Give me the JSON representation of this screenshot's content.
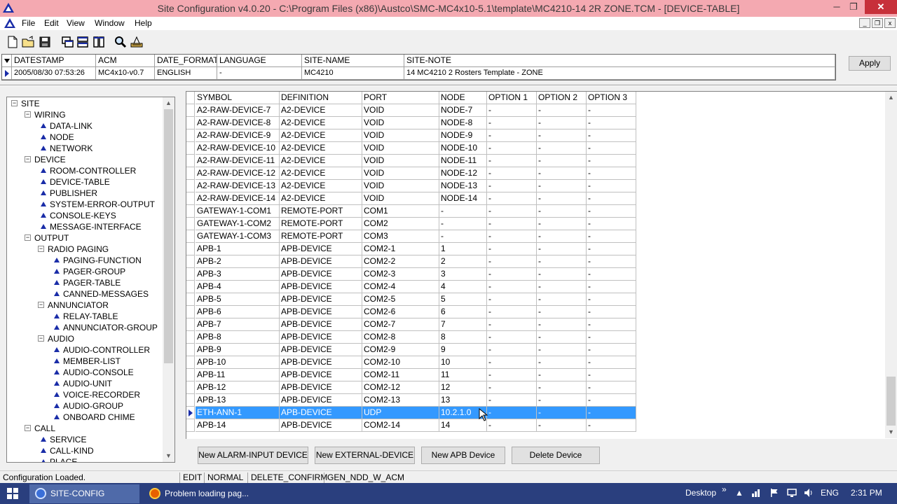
{
  "window": {
    "title": "Site Configuration v4.0.20 - C:\\Program Files (x86)\\Austco\\SMC-MC4x10-5.1\\template\\MC4210-14 2R ZONE.TCM - [DEVICE-TABLE]",
    "min": "─",
    "max": "❐",
    "close": "✕"
  },
  "menu": {
    "items": [
      "File",
      "Edit",
      "View",
      "Window",
      "Help"
    ],
    "mdi": [
      "_",
      "❐",
      "x"
    ]
  },
  "toolbar": {
    "icons": [
      "new-file-icon",
      "open-folder-icon",
      "save-icon",
      "cascade-icon",
      "tile-horizontal-icon",
      "tile-vertical-icon",
      "find-icon",
      "tool-icon"
    ]
  },
  "site_header": {
    "columns": [
      "DATESTAMP",
      "ACM",
      "DATE_FORMAT",
      "LANGUAGE",
      "SITE-NAME",
      "SITE-NOTE"
    ],
    "values": [
      "2005/08/30 07:53:26",
      "MC4x10-v0.7",
      "ENGLISH",
      "-",
      "MC4210",
      "14 MC4210 2 Rosters Template - ZONE"
    ],
    "apply_label": "Apply"
  },
  "tree": {
    "items": [
      {
        "label": "SITE",
        "level": 0,
        "type": "branch"
      },
      {
        "label": "WIRING",
        "level": 1,
        "type": "branch"
      },
      {
        "label": "DATA-LINK",
        "level": 2,
        "type": "leaf"
      },
      {
        "label": "NODE",
        "level": 2,
        "type": "leaf"
      },
      {
        "label": "NETWORK",
        "level": 2,
        "type": "leaf"
      },
      {
        "label": "DEVICE",
        "level": 1,
        "type": "branch"
      },
      {
        "label": "ROOM-CONTROLLER",
        "level": 2,
        "type": "leaf"
      },
      {
        "label": "DEVICE-TABLE",
        "level": 2,
        "type": "leaf"
      },
      {
        "label": "PUBLISHER",
        "level": 2,
        "type": "leaf"
      },
      {
        "label": "SYSTEM-ERROR-OUTPUT",
        "level": 2,
        "type": "leaf"
      },
      {
        "label": "CONSOLE-KEYS",
        "level": 2,
        "type": "leaf"
      },
      {
        "label": "MESSAGE-INTERFACE",
        "level": 2,
        "type": "leaf"
      },
      {
        "label": "OUTPUT",
        "level": 1,
        "type": "branch"
      },
      {
        "label": "RADIO PAGING",
        "level": 2,
        "type": "branch"
      },
      {
        "label": "PAGING-FUNCTION",
        "level": 3,
        "type": "leaf"
      },
      {
        "label": "PAGER-GROUP",
        "level": 3,
        "type": "leaf"
      },
      {
        "label": "PAGER-TABLE",
        "level": 3,
        "type": "leaf"
      },
      {
        "label": "CANNED-MESSAGES",
        "level": 3,
        "type": "leaf"
      },
      {
        "label": "ANNUNCIATOR",
        "level": 2,
        "type": "branch"
      },
      {
        "label": "RELAY-TABLE",
        "level": 3,
        "type": "leaf"
      },
      {
        "label": "ANNUNCIATOR-GROUP",
        "level": 3,
        "type": "leaf"
      },
      {
        "label": "AUDIO",
        "level": 2,
        "type": "branch"
      },
      {
        "label": "AUDIO-CONTROLLER",
        "level": 3,
        "type": "leaf"
      },
      {
        "label": "MEMBER-LIST",
        "level": 3,
        "type": "leaf"
      },
      {
        "label": "AUDIO-CONSOLE",
        "level": 3,
        "type": "leaf"
      },
      {
        "label": "AUDIO-UNIT",
        "level": 3,
        "type": "leaf"
      },
      {
        "label": "VOICE-RECORDER",
        "level": 3,
        "type": "leaf"
      },
      {
        "label": "AUDIO-GROUP",
        "level": 3,
        "type": "leaf"
      },
      {
        "label": "ONBOARD CHIME",
        "level": 3,
        "type": "leaf"
      },
      {
        "label": "CALL",
        "level": 1,
        "type": "branch"
      },
      {
        "label": "SERVICE",
        "level": 2,
        "type": "leaf"
      },
      {
        "label": "CALL-KIND",
        "level": 2,
        "type": "leaf"
      },
      {
        "label": "PLACE",
        "level": 2,
        "type": "leaf"
      }
    ]
  },
  "device_table": {
    "columns": [
      "SYMBOL",
      "DEFINITION",
      "PORT",
      "NODE",
      "OPTION 1",
      "OPTION 2",
      "OPTION 3"
    ],
    "selected_index": 26,
    "rows": [
      [
        "A2-RAW-DEVICE-7",
        "A2-DEVICE",
        "VOID",
        "NODE-7",
        "-",
        "-",
        "-"
      ],
      [
        "A2-RAW-DEVICE-8",
        "A2-DEVICE",
        "VOID",
        "NODE-8",
        "-",
        "-",
        "-"
      ],
      [
        "A2-RAW-DEVICE-9",
        "A2-DEVICE",
        "VOID",
        "NODE-9",
        "-",
        "-",
        "-"
      ],
      [
        "A2-RAW-DEVICE-10",
        "A2-DEVICE",
        "VOID",
        "NODE-10",
        "-",
        "-",
        "-"
      ],
      [
        "A2-RAW-DEVICE-11",
        "A2-DEVICE",
        "VOID",
        "NODE-11",
        "-",
        "-",
        "-"
      ],
      [
        "A2-RAW-DEVICE-12",
        "A2-DEVICE",
        "VOID",
        "NODE-12",
        "-",
        "-",
        "-"
      ],
      [
        "A2-RAW-DEVICE-13",
        "A2-DEVICE",
        "VOID",
        "NODE-13",
        "-",
        "-",
        "-"
      ],
      [
        "A2-RAW-DEVICE-14",
        "A2-DEVICE",
        "VOID",
        "NODE-14",
        "-",
        "-",
        "-"
      ],
      [
        "GATEWAY-1-COM1",
        "REMOTE-PORT",
        "COM1",
        "-",
        "-",
        "-",
        "-"
      ],
      [
        "GATEWAY-1-COM2",
        "REMOTE-PORT",
        "COM2",
        "-",
        "-",
        "-",
        "-"
      ],
      [
        "GATEWAY-1-COM3",
        "REMOTE-PORT",
        "COM3",
        "-",
        "-",
        "-",
        "-"
      ],
      [
        "APB-1",
        "APB-DEVICE",
        "COM2-1",
        "1",
        "-",
        "-",
        "-"
      ],
      [
        "APB-2",
        "APB-DEVICE",
        "COM2-2",
        "2",
        "-",
        "-",
        "-"
      ],
      [
        "APB-3",
        "APB-DEVICE",
        "COM2-3",
        "3",
        "-",
        "-",
        "-"
      ],
      [
        "APB-4",
        "APB-DEVICE",
        "COM2-4",
        "4",
        "-",
        "-",
        "-"
      ],
      [
        "APB-5",
        "APB-DEVICE",
        "COM2-5",
        "5",
        "-",
        "-",
        "-"
      ],
      [
        "APB-6",
        "APB-DEVICE",
        "COM2-6",
        "6",
        "-",
        "-",
        "-"
      ],
      [
        "APB-7",
        "APB-DEVICE",
        "COM2-7",
        "7",
        "-",
        "-",
        "-"
      ],
      [
        "APB-8",
        "APB-DEVICE",
        "COM2-8",
        "8",
        "-",
        "-",
        "-"
      ],
      [
        "APB-9",
        "APB-DEVICE",
        "COM2-9",
        "9",
        "-",
        "-",
        "-"
      ],
      [
        "APB-10",
        "APB-DEVICE",
        "COM2-10",
        "10",
        "-",
        "-",
        "-"
      ],
      [
        "APB-11",
        "APB-DEVICE",
        "COM2-11",
        "11",
        "-",
        "-",
        "-"
      ],
      [
        "APB-12",
        "APB-DEVICE",
        "COM2-12",
        "12",
        "-",
        "-",
        "-"
      ],
      [
        "APB-13",
        "APB-DEVICE",
        "COM2-13",
        "13",
        "-",
        "-",
        "-"
      ],
      [
        "ETH-ANN-1",
        "APB-DEVICE",
        "UDP",
        "10.2.1.0",
        "-",
        "-",
        "-"
      ],
      [
        "APB-14",
        "APB-DEVICE",
        "COM2-14",
        "14",
        "-",
        "-",
        "-"
      ]
    ]
  },
  "actions": {
    "new_alarm": "New ALARM-INPUT DEVICE",
    "new_external": "New EXTERNAL-DEVICE",
    "new_apb": "New APB Device",
    "delete": "Delete Device"
  },
  "status": {
    "message": "Configuration Loaded.",
    "mode1": "EDIT",
    "mode2": "NORMAL",
    "mode3": "DELETE_CONFIRM",
    "mode4": "GEN_NDD_W_ACM"
  },
  "taskbar": {
    "tasks": [
      "SITE-CONFIG",
      "Problem loading pag..."
    ],
    "desktop": "Desktop",
    "lang": "ENG",
    "time": "2:31 PM"
  },
  "colors": {
    "titlebar": "#f4a9b1",
    "selection": "#3399ff",
    "taskbar": "#2a3f7e",
    "tree_marker": "#1a2da8"
  }
}
